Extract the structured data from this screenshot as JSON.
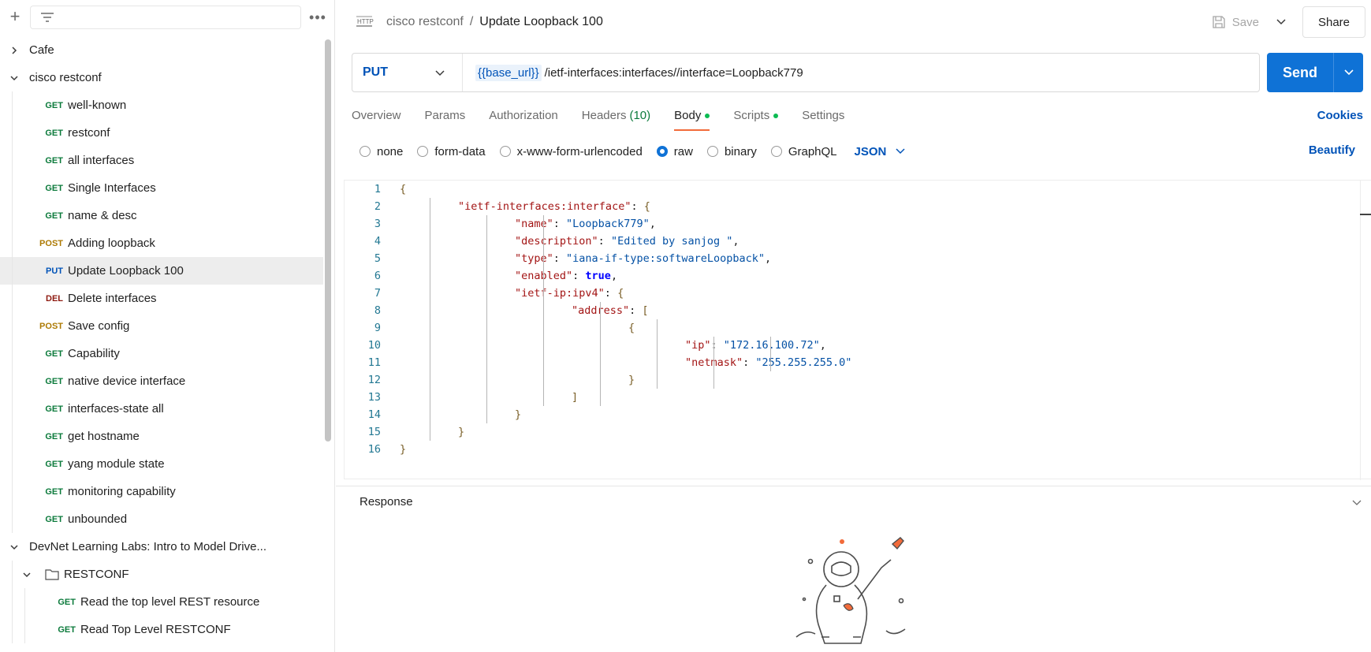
{
  "sidebar": {
    "collections": [
      {
        "name": "Cafe",
        "expanded": false
      },
      {
        "name": "cisco restconf",
        "expanded": true
      }
    ],
    "requests": [
      {
        "method": "GET",
        "name": "well-known"
      },
      {
        "method": "GET",
        "name": "restconf"
      },
      {
        "method": "GET",
        "name": "all interfaces"
      },
      {
        "method": "GET",
        "name": "Single Interfaces"
      },
      {
        "method": "GET",
        "name": "name & desc"
      },
      {
        "method": "POST",
        "name": "Adding loopback"
      },
      {
        "method": "PUT",
        "name": "Update Loopback 100"
      },
      {
        "method": "DEL",
        "name": "Delete interfaces"
      },
      {
        "method": "POST",
        "name": "Save config"
      },
      {
        "method": "GET",
        "name": "Capability"
      },
      {
        "method": "GET",
        "name": "native device interface"
      },
      {
        "method": "GET",
        "name": "interfaces-state all"
      },
      {
        "method": "GET",
        "name": "get hostname"
      },
      {
        "method": "GET",
        "name": "yang module state"
      },
      {
        "method": "GET",
        "name": "monitoring capability"
      },
      {
        "method": "GET",
        "name": "unbounded"
      }
    ],
    "collection3": "DevNet Learning Labs: Intro to Model Drive...",
    "folder": "RESTCONF",
    "folder_requests": [
      {
        "method": "GET",
        "name": "Read the top level REST resource"
      },
      {
        "method": "GET",
        "name": "Read Top Level RESTCONF"
      }
    ]
  },
  "header": {
    "http_icon": "HTTP",
    "collection": "cisco restconf",
    "separator": "/",
    "request_name": "Update Loopback 100",
    "save_label": "Save",
    "share_label": "Share"
  },
  "request": {
    "method": "PUT",
    "url_variable": "{{base_url}}",
    "url_path": "/ietf-interfaces:interfaces//interface=Loopback779",
    "send_label": "Send"
  },
  "tabs": {
    "overview": "Overview",
    "params": "Params",
    "authorization": "Authorization",
    "headers": "Headers",
    "headers_count": "(10)",
    "body": "Body",
    "scripts": "Scripts",
    "settings": "Settings",
    "cookies": "Cookies"
  },
  "body_types": {
    "none": "none",
    "form_data": "form-data",
    "urlencoded": "x-www-form-urlencoded",
    "raw": "raw",
    "binary": "binary",
    "graphql": "GraphQL",
    "format": "JSON",
    "beautify": "Beautify"
  },
  "editor": {
    "line_numbers": [
      "1",
      "2",
      "3",
      "4",
      "5",
      "6",
      "7",
      "8",
      "9",
      "10",
      "11",
      "12",
      "13",
      "14",
      "15",
      "16"
    ],
    "l2_key": "\"ietf-interfaces:interface\"",
    "l3_key": "\"name\"",
    "l3_val": "\"Loopback779\"",
    "l4_key": "\"description\"",
    "l4_val": "\"Edited by sanjog \"",
    "l5_key": "\"type\"",
    "l5_val": "\"iana-if-type:softwareLoopback\"",
    "l6_key": "\"enabled\"",
    "l6_val": "true",
    "l7_key": "\"ietf-ip:ipv4\"",
    "l8_key": "\"address\"",
    "l10_key": "\"ip\"",
    "l10_val": "\"172.16.100.72\"",
    "l11_key": "\"netmask\"",
    "l11_val": "\"255.255.255.0\""
  },
  "response": {
    "title": "Response"
  }
}
